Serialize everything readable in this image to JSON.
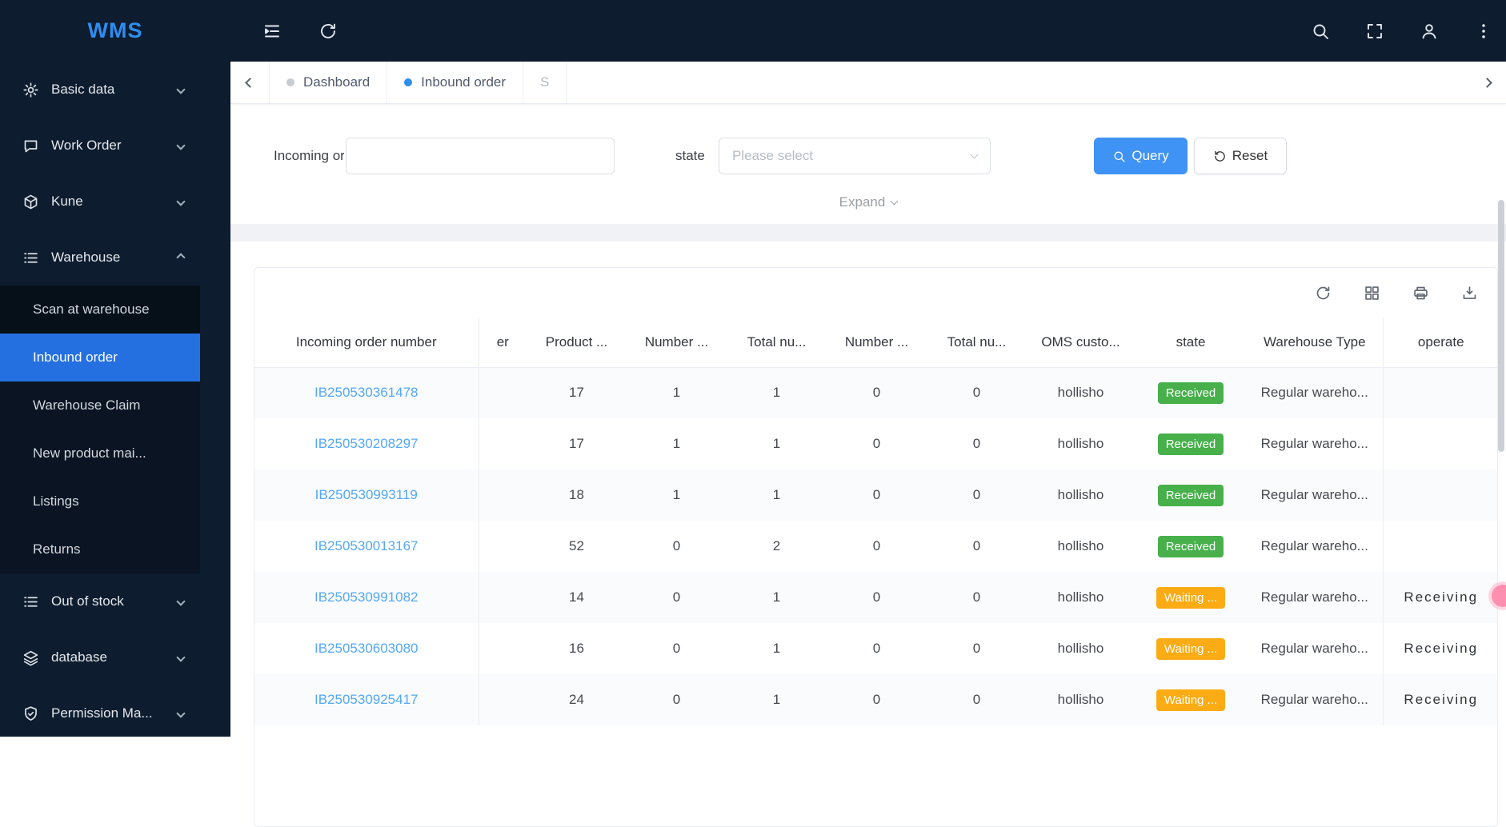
{
  "app": {
    "logo": "WMS"
  },
  "colors": {
    "accent": "#3f93f5",
    "sidebar_bg": "#0d1c2e",
    "active_menu_bg": "#2470e0",
    "success_badge": "#47b04b",
    "warning_badge": "#fbab13",
    "link": "#54a8f8"
  },
  "icons": {
    "topbar": [
      "menu-collapse-icon",
      "refresh-icon",
      "search-icon",
      "fullscreen-icon",
      "user-icon",
      "more-vertical-icon"
    ],
    "table_toolbar": [
      "refresh-icon",
      "columns-icon",
      "print-icon",
      "export-icon"
    ]
  },
  "sidebar": {
    "items": [
      {
        "label": "Basic data",
        "icon": "gear-icon",
        "expanded": false
      },
      {
        "label": "Work Order",
        "icon": "chat-icon",
        "expanded": false
      },
      {
        "label": "Kune",
        "icon": "cube-icon",
        "expanded": false
      },
      {
        "label": "Warehouse",
        "icon": "list-icon",
        "expanded": true,
        "children": [
          {
            "label": "Scan at warehouse",
            "state": "hover"
          },
          {
            "label": "Inbound order",
            "state": "active"
          },
          {
            "label": "Warehouse Claim",
            "state": ""
          },
          {
            "label": "New product mai...",
            "state": ""
          },
          {
            "label": "Listings",
            "state": ""
          },
          {
            "label": "Returns",
            "state": ""
          }
        ]
      },
      {
        "label": "Out of stock",
        "icon": "list-icon",
        "expanded": false
      },
      {
        "label": "database",
        "icon": "layers-icon",
        "expanded": false
      },
      {
        "label": "Permission Ma...",
        "icon": "shield-icon",
        "expanded": false
      }
    ]
  },
  "tabbar": {
    "tabs": [
      {
        "label": "Dashboard",
        "dot": "gray",
        "active": false,
        "muted": false
      },
      {
        "label": "Inbound order",
        "dot": "blue",
        "active": true,
        "muted": false
      },
      {
        "label": "S",
        "dot": "none",
        "active": false,
        "muted": true
      }
    ]
  },
  "filters": {
    "incoming_order_label": "Incoming or",
    "incoming_order_value": "",
    "state_label": "state",
    "state_placeholder": "Please select",
    "query_button": "Query",
    "reset_button": "Reset",
    "expand_toggle": "Expand"
  },
  "table": {
    "headers": [
      "Incoming order number",
      "er",
      "Product ...",
      "Number ...",
      "Total nu...",
      "Number ...",
      "Total nu...",
      "OMS custo...",
      "state",
      "Warehouse Type",
      "operate"
    ],
    "rows": [
      {
        "order_no": "IB250530361478",
        "c2": "",
        "product": "17",
        "n1": "1",
        "t1": "1",
        "n2": "0",
        "t2": "0",
        "oms": "hollisho",
        "state": "Received",
        "state_type": "success",
        "warehouse": "Regular wareho...",
        "operate": ""
      },
      {
        "order_no": "IB250530208297",
        "c2": "",
        "product": "17",
        "n1": "1",
        "t1": "1",
        "n2": "0",
        "t2": "0",
        "oms": "hollisho",
        "state": "Received",
        "state_type": "success",
        "warehouse": "Regular wareho...",
        "operate": ""
      },
      {
        "order_no": "IB250530993119",
        "c2": "",
        "product": "18",
        "n1": "1",
        "t1": "1",
        "n2": "0",
        "t2": "0",
        "oms": "hollisho",
        "state": "Received",
        "state_type": "success",
        "warehouse": "Regular wareho...",
        "operate": ""
      },
      {
        "order_no": "IB250530013167",
        "c2": "",
        "product": "52",
        "n1": "0",
        "t1": "2",
        "n2": "0",
        "t2": "0",
        "oms": "hollisho",
        "state": "Received",
        "state_type": "success",
        "warehouse": "Regular wareho...",
        "operate": ""
      },
      {
        "order_no": "IB250530991082",
        "c2": "",
        "product": "14",
        "n1": "0",
        "t1": "1",
        "n2": "0",
        "t2": "0",
        "oms": "hollisho",
        "state": "Waiting ...",
        "state_type": "warning",
        "warehouse": "Regular wareho...",
        "operate": "Receiving"
      },
      {
        "order_no": "IB250530603080",
        "c2": "",
        "product": "16",
        "n1": "0",
        "t1": "1",
        "n2": "0",
        "t2": "0",
        "oms": "hollisho",
        "state": "Waiting ...",
        "state_type": "warning",
        "warehouse": "Regular wareho...",
        "operate": "Receiving"
      },
      {
        "order_no": "IB250530925417",
        "c2": "",
        "product": "24",
        "n1": "0",
        "t1": "1",
        "n2": "0",
        "t2": "0",
        "oms": "hollisho",
        "state": "Waiting ...",
        "state_type": "warning",
        "warehouse": "Regular wareho...",
        "operate": "Receiving"
      }
    ]
  }
}
